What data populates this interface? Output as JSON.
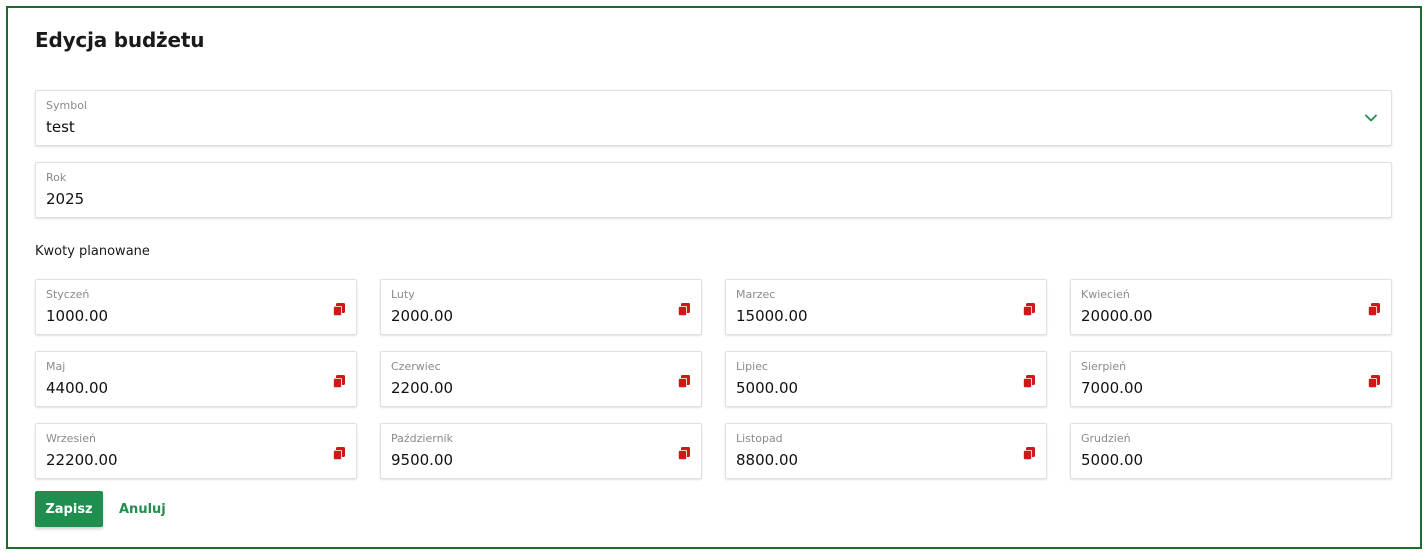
{
  "form": {
    "title": "Edycja budżetu",
    "symbol": {
      "label": "Symbol",
      "value": "test",
      "icon": "chevron-down-icon"
    },
    "rok": {
      "label": "Rok",
      "value": "2025"
    },
    "section_label": "Kwoty planowane",
    "months": [
      {
        "label": "Styczeń",
        "value": "1000.00",
        "copy": true
      },
      {
        "label": "Luty",
        "value": "2000.00",
        "copy": true
      },
      {
        "label": "Marzec",
        "value": "15000.00",
        "copy": true
      },
      {
        "label": "Kwiecień",
        "value": "20000.00",
        "copy": true
      },
      {
        "label": "Maj",
        "value": "4400.00",
        "copy": true
      },
      {
        "label": "Czerwiec",
        "value": "2200.00",
        "copy": true
      },
      {
        "label": "Lipiec",
        "value": "5000.00",
        "copy": true
      },
      {
        "label": "Sierpień",
        "value": "7000.00",
        "copy": true
      },
      {
        "label": "Wrzesień",
        "value": "22200.00",
        "copy": true
      },
      {
        "label": "Październik",
        "value": "9500.00",
        "copy": true
      },
      {
        "label": "Listopad",
        "value": "8800.00",
        "copy": true
      },
      {
        "label": "Grudzień",
        "value": "5000.00",
        "copy": false
      }
    ],
    "buttons": {
      "save": "Zapisz",
      "cancel": "Anuluj"
    }
  },
  "colors": {
    "accent_green": "#1e8f4e",
    "border_green": "#1e6b2e",
    "copy_icon_red": "#d01818"
  }
}
